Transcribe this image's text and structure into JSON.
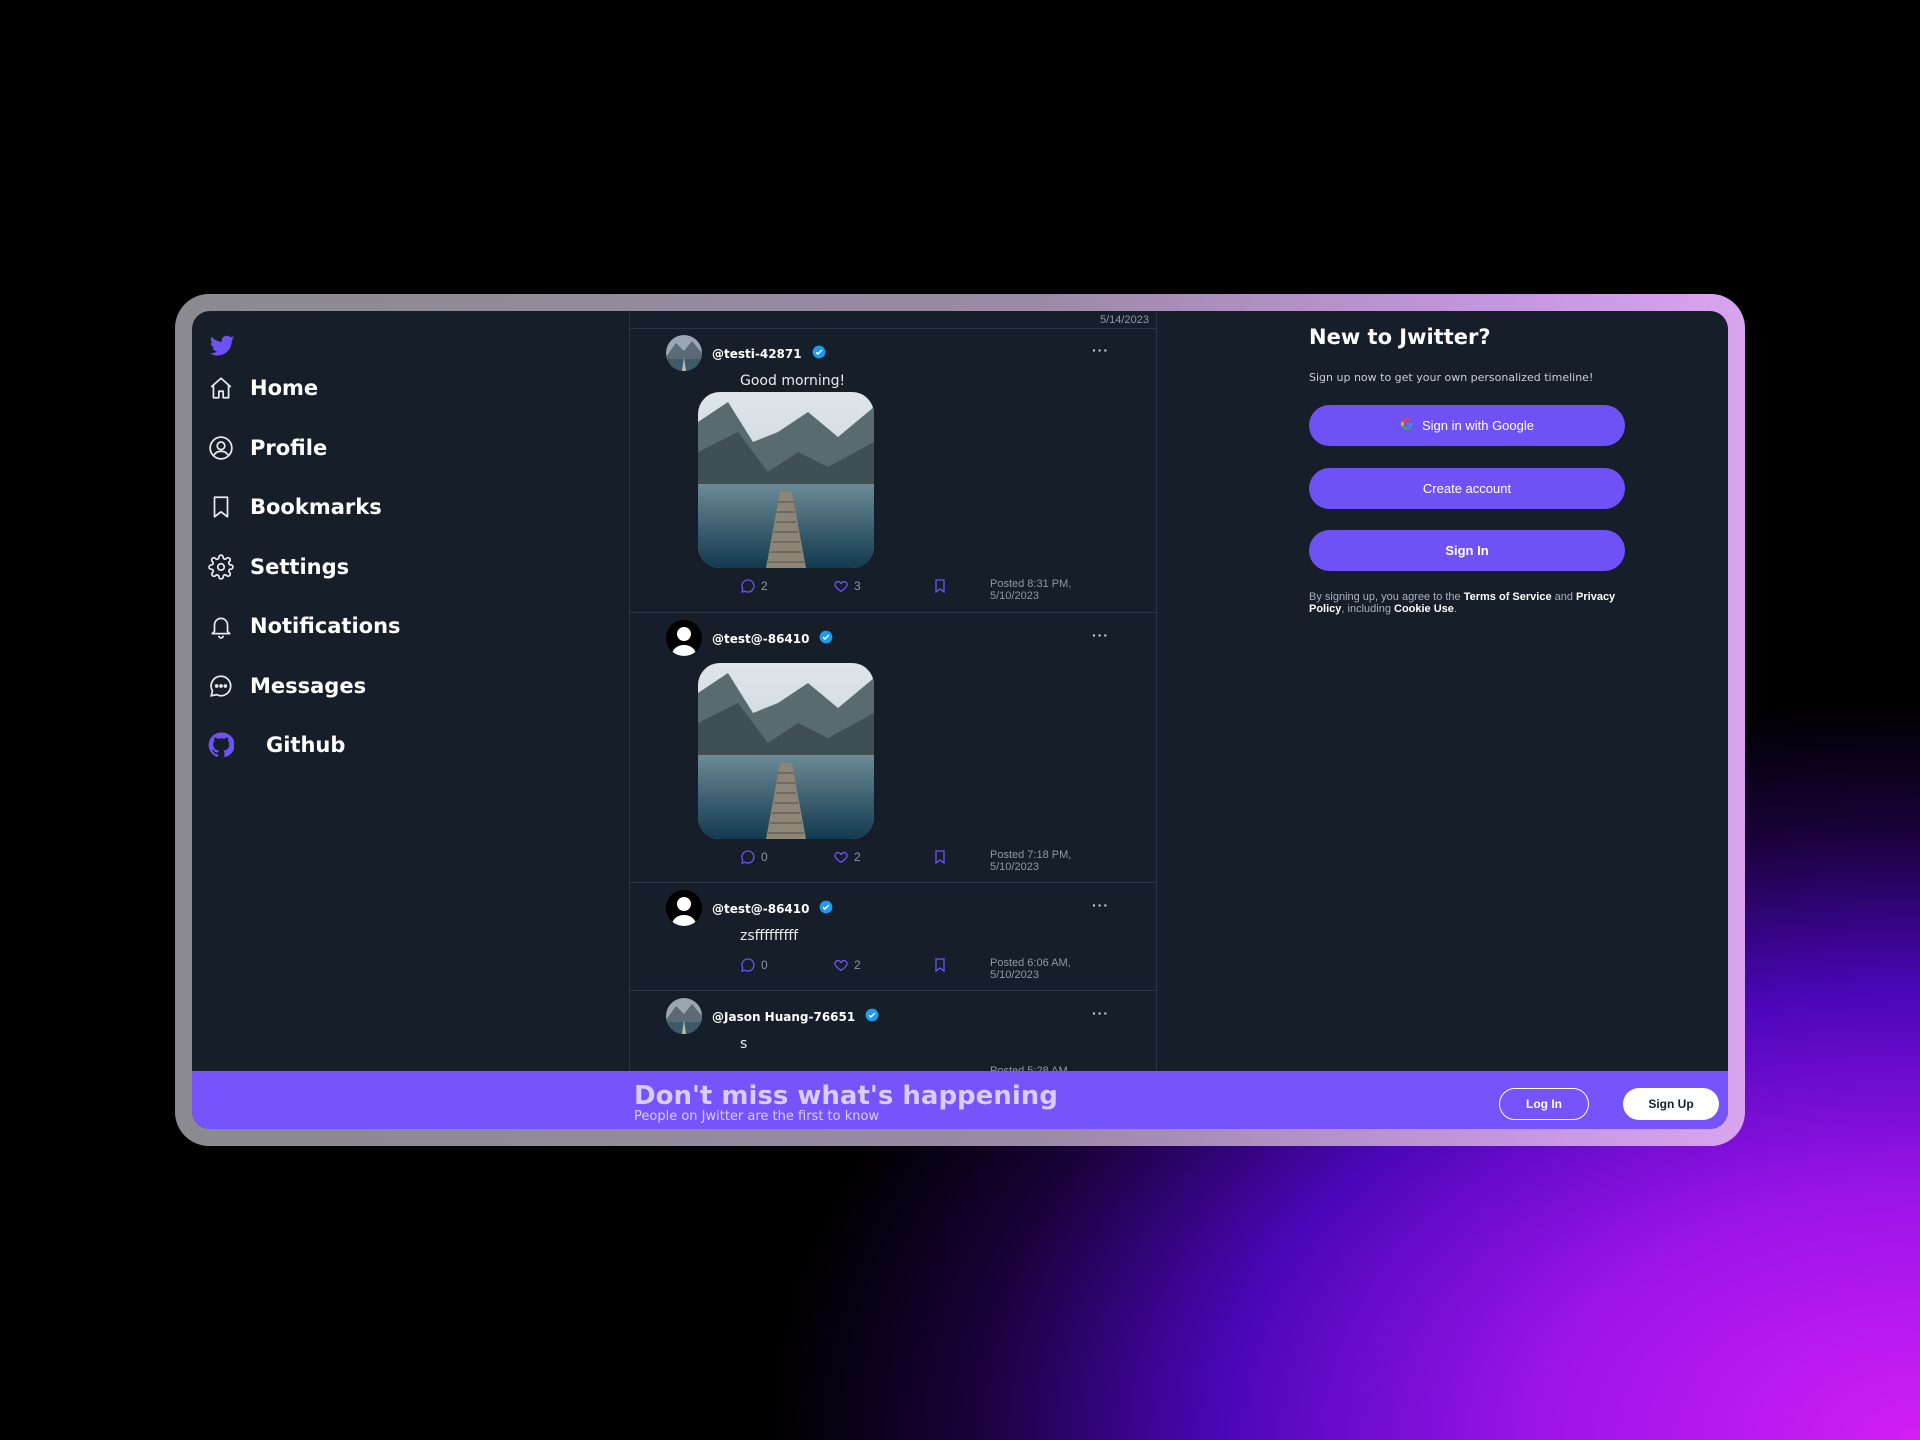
{
  "app": {
    "name": "Jwitter"
  },
  "colors": {
    "accent": "#6f52f5",
    "banner": "#7654fb",
    "background": "#151e29",
    "verified": "#1d9bf0"
  },
  "sidebar": {
    "items": [
      {
        "label": "Home",
        "icon": "home-icon"
      },
      {
        "label": "Profile",
        "icon": "user-circle-icon"
      },
      {
        "label": "Bookmarks",
        "icon": "bookmark-icon"
      },
      {
        "label": "Settings",
        "icon": "gear-icon"
      },
      {
        "label": "Notifications",
        "icon": "bell-icon"
      },
      {
        "label": "Messages",
        "icon": "chat-bubble-icon"
      },
      {
        "label": "Github",
        "icon": "github-icon"
      }
    ]
  },
  "feed": {
    "posts": [
      {
        "handle": "@testi-42871",
        "text": "Good morning!",
        "comments": "2",
        "likes": "3",
        "posted_line1": "Posted 8:31 PM,",
        "posted_line2": "5/10/2023"
      },
      {
        "handle": "@test@-86410",
        "text": "",
        "comments": "0",
        "likes": "2",
        "posted_line1": "Posted 7:18 PM,",
        "posted_line2": "5/10/2023"
      },
      {
        "handle": "@test@-86410",
        "text": "zsfffffffff",
        "comments": "0",
        "likes": "2",
        "posted_line1": "Posted 6:06 AM,",
        "posted_line2": "5/10/2023"
      },
      {
        "handle": "@Jason Huang-76651",
        "text": "s",
        "comments": "",
        "likes": "",
        "posted_line1": "Posted 5:28 AM",
        "posted_line2": ""
      }
    ],
    "partial_top_date": "5/14/2023"
  },
  "right_panel": {
    "title": "New to Jwitter?",
    "subtitle": "Sign up now to get your own personalized timeline!",
    "google_button": "Sign in with Google",
    "create_button": "Create account",
    "signin_button": "Sign In",
    "terms": {
      "prefix": "By signing up, you agree to the ",
      "tos": "Terms of Service",
      "and": " and ",
      "privacy": "Privacy Policy",
      "including": ", including ",
      "cookie": "Cookie Use",
      "end": "."
    }
  },
  "banner": {
    "title": "Don't miss what's happening",
    "subtitle": "People on Jwitter are the first to know",
    "login_button": "Log In",
    "signup_button": "Sign Up"
  }
}
